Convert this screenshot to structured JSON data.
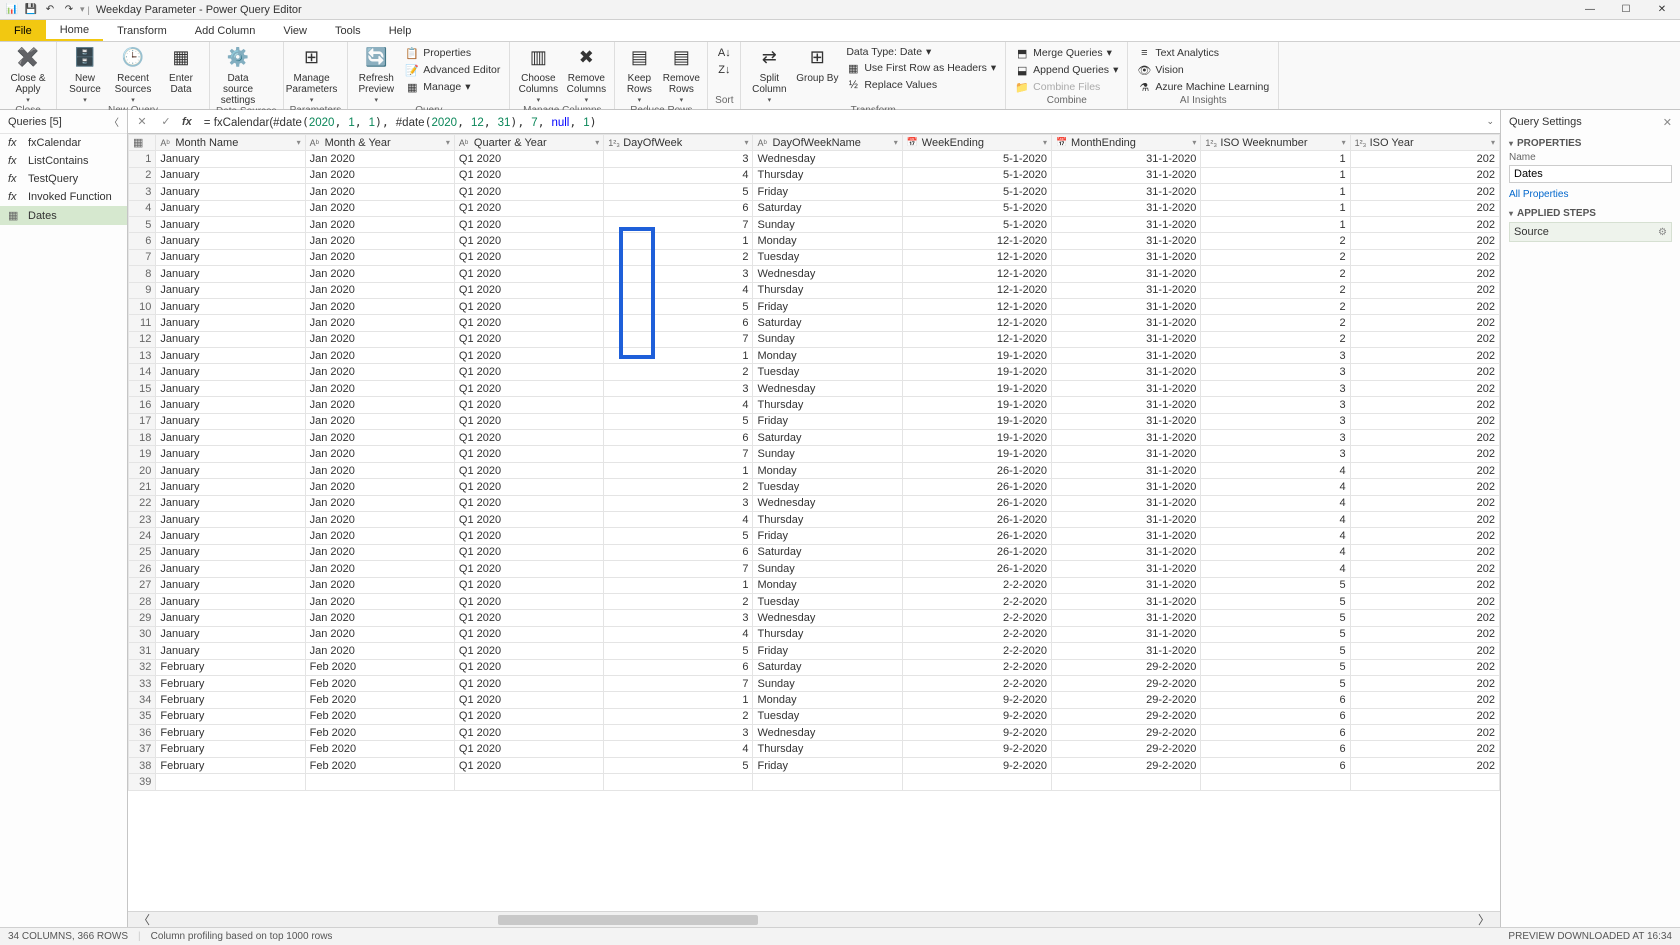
{
  "titlebar": {
    "app_icon": "📊",
    "title": "Weekday Parameter - Power Query Editor",
    "win_min": "—",
    "win_max": "☐",
    "win_close": "✕"
  },
  "ribbon": {
    "tabs": {
      "file": "File",
      "home": "Home",
      "transform": "Transform",
      "add_column": "Add Column",
      "view": "View",
      "tools": "Tools",
      "help": "Help"
    },
    "groups": {
      "close": {
        "label": "Close",
        "close_apply": "Close & Apply"
      },
      "new_query": {
        "label": "New Query",
        "new_source": "New Source",
        "recent_sources": "Recent Sources",
        "enter_data": "Enter Data"
      },
      "data_sources": {
        "label": "Data Sources",
        "data_source_settings": "Data source settings"
      },
      "parameters": {
        "label": "Parameters",
        "manage_parameters": "Manage Parameters"
      },
      "query": {
        "label": "Query",
        "refresh": "Refresh Preview",
        "properties": "Properties",
        "advanced_editor": "Advanced Editor",
        "manage": "Manage"
      },
      "manage_columns": {
        "label": "Manage Columns",
        "choose": "Choose Columns",
        "remove": "Remove Columns"
      },
      "reduce_rows": {
        "label": "Reduce Rows",
        "keep": "Keep Rows",
        "remove": "Remove Rows"
      },
      "sort": {
        "label": "Sort"
      },
      "transform": {
        "label": "Transform",
        "split": "Split Column",
        "group": "Group By",
        "data_type": "Data Type: Date",
        "first_row": "Use First Row as Headers",
        "replace": "Replace Values"
      },
      "combine": {
        "label": "Combine",
        "merge": "Merge Queries",
        "append": "Append Queries",
        "combine_files": "Combine Files"
      },
      "ai": {
        "label": "AI Insights",
        "text": "Text Analytics",
        "vision": "Vision",
        "aml": "Azure Machine Learning"
      }
    }
  },
  "queries": {
    "header": "Queries [5]",
    "items": [
      {
        "icon": "fx",
        "label": "fxCalendar",
        "fx": true
      },
      {
        "icon": "fx",
        "label": "ListContains",
        "fx": true
      },
      {
        "icon": "fx",
        "label": "TestQuery",
        "fx": true
      },
      {
        "icon": "fx",
        "label": "Invoked Function",
        "fx": true
      },
      {
        "icon": "▦",
        "label": "Dates",
        "fx": false,
        "selected": true
      }
    ]
  },
  "formula": {
    "prefix": "= ",
    "func1": "fxCalendar(",
    "func2": "#date",
    "lp": "(",
    "rp": ")",
    "comma": ", ",
    "n2020": "2020",
    "n1": "1",
    "n12": "12",
    "n31": "31",
    "n7": "7",
    "null": "null"
  },
  "grid": {
    "columns": [
      {
        "key": "MonthName",
        "label": "Month Name",
        "type": "Aᵇ",
        "align": "left"
      },
      {
        "key": "MonthYear",
        "label": "Month & Year",
        "type": "Aᵇ",
        "align": "left"
      },
      {
        "key": "QuarterYear",
        "label": "Quarter & Year",
        "type": "Aᵇ",
        "align": "left"
      },
      {
        "key": "DayOfWeek",
        "label": "DayOfWeek",
        "type": "1²₃",
        "align": "right"
      },
      {
        "key": "DayOfWeekName",
        "label": "DayOfWeekName",
        "type": "Aᵇ",
        "align": "left"
      },
      {
        "key": "WeekEnding",
        "label": "WeekEnding",
        "type": "📅",
        "align": "right"
      },
      {
        "key": "MonthEnding",
        "label": "MonthEnding",
        "type": "📅",
        "align": "right"
      },
      {
        "key": "ISOWeek",
        "label": "ISO Weeknumber",
        "type": "1²₃",
        "align": "right"
      },
      {
        "key": "ISOYear",
        "label": "ISO Year",
        "type": "1²₃",
        "align": "right"
      }
    ],
    "rows": [
      {
        "n": 1,
        "MonthName": "January",
        "MonthYear": "Jan 2020",
        "QuarterYear": "Q1 2020",
        "DayOfWeek": "3",
        "DayOfWeekName": "Wednesday",
        "WeekEnding": "5-1-2020",
        "MonthEnding": "31-1-2020",
        "ISOWeek": "1",
        "ISOYear": "202"
      },
      {
        "n": 2,
        "MonthName": "January",
        "MonthYear": "Jan 2020",
        "QuarterYear": "Q1 2020",
        "DayOfWeek": "4",
        "DayOfWeekName": "Thursday",
        "WeekEnding": "5-1-2020",
        "MonthEnding": "31-1-2020",
        "ISOWeek": "1",
        "ISOYear": "202"
      },
      {
        "n": 3,
        "MonthName": "January",
        "MonthYear": "Jan 2020",
        "QuarterYear": "Q1 2020",
        "DayOfWeek": "5",
        "DayOfWeekName": "Friday",
        "WeekEnding": "5-1-2020",
        "MonthEnding": "31-1-2020",
        "ISOWeek": "1",
        "ISOYear": "202"
      },
      {
        "n": 4,
        "MonthName": "January",
        "MonthYear": "Jan 2020",
        "QuarterYear": "Q1 2020",
        "DayOfWeek": "6",
        "DayOfWeekName": "Saturday",
        "WeekEnding": "5-1-2020",
        "MonthEnding": "31-1-2020",
        "ISOWeek": "1",
        "ISOYear": "202"
      },
      {
        "n": 5,
        "MonthName": "January",
        "MonthYear": "Jan 2020",
        "QuarterYear": "Q1 2020",
        "DayOfWeek": "7",
        "DayOfWeekName": "Sunday",
        "WeekEnding": "5-1-2020",
        "MonthEnding": "31-1-2020",
        "ISOWeek": "1",
        "ISOYear": "202"
      },
      {
        "n": 6,
        "MonthName": "January",
        "MonthYear": "Jan 2020",
        "QuarterYear": "Q1 2020",
        "DayOfWeek": "1",
        "DayOfWeekName": "Monday",
        "WeekEnding": "12-1-2020",
        "MonthEnding": "31-1-2020",
        "ISOWeek": "2",
        "ISOYear": "202"
      },
      {
        "n": 7,
        "MonthName": "January",
        "MonthYear": "Jan 2020",
        "QuarterYear": "Q1 2020",
        "DayOfWeek": "2",
        "DayOfWeekName": "Tuesday",
        "WeekEnding": "12-1-2020",
        "MonthEnding": "31-1-2020",
        "ISOWeek": "2",
        "ISOYear": "202"
      },
      {
        "n": 8,
        "MonthName": "January",
        "MonthYear": "Jan 2020",
        "QuarterYear": "Q1 2020",
        "DayOfWeek": "3",
        "DayOfWeekName": "Wednesday",
        "WeekEnding": "12-1-2020",
        "MonthEnding": "31-1-2020",
        "ISOWeek": "2",
        "ISOYear": "202"
      },
      {
        "n": 9,
        "MonthName": "January",
        "MonthYear": "Jan 2020",
        "QuarterYear": "Q1 2020",
        "DayOfWeek": "4",
        "DayOfWeekName": "Thursday",
        "WeekEnding": "12-1-2020",
        "MonthEnding": "31-1-2020",
        "ISOWeek": "2",
        "ISOYear": "202"
      },
      {
        "n": 10,
        "MonthName": "January",
        "MonthYear": "Jan 2020",
        "QuarterYear": "Q1 2020",
        "DayOfWeek": "5",
        "DayOfWeekName": "Friday",
        "WeekEnding": "12-1-2020",
        "MonthEnding": "31-1-2020",
        "ISOWeek": "2",
        "ISOYear": "202"
      },
      {
        "n": 11,
        "MonthName": "January",
        "MonthYear": "Jan 2020",
        "QuarterYear": "Q1 2020",
        "DayOfWeek": "6",
        "DayOfWeekName": "Saturday",
        "WeekEnding": "12-1-2020",
        "MonthEnding": "31-1-2020",
        "ISOWeek": "2",
        "ISOYear": "202"
      },
      {
        "n": 12,
        "MonthName": "January",
        "MonthYear": "Jan 2020",
        "QuarterYear": "Q1 2020",
        "DayOfWeek": "7",
        "DayOfWeekName": "Sunday",
        "WeekEnding": "12-1-2020",
        "MonthEnding": "31-1-2020",
        "ISOWeek": "2",
        "ISOYear": "202"
      },
      {
        "n": 13,
        "MonthName": "January",
        "MonthYear": "Jan 2020",
        "QuarterYear": "Q1 2020",
        "DayOfWeek": "1",
        "DayOfWeekName": "Monday",
        "WeekEnding": "19-1-2020",
        "MonthEnding": "31-1-2020",
        "ISOWeek": "3",
        "ISOYear": "202"
      },
      {
        "n": 14,
        "MonthName": "January",
        "MonthYear": "Jan 2020",
        "QuarterYear": "Q1 2020",
        "DayOfWeek": "2",
        "DayOfWeekName": "Tuesday",
        "WeekEnding": "19-1-2020",
        "MonthEnding": "31-1-2020",
        "ISOWeek": "3",
        "ISOYear": "202"
      },
      {
        "n": 15,
        "MonthName": "January",
        "MonthYear": "Jan 2020",
        "QuarterYear": "Q1 2020",
        "DayOfWeek": "3",
        "DayOfWeekName": "Wednesday",
        "WeekEnding": "19-1-2020",
        "MonthEnding": "31-1-2020",
        "ISOWeek": "3",
        "ISOYear": "202"
      },
      {
        "n": 16,
        "MonthName": "January",
        "MonthYear": "Jan 2020",
        "QuarterYear": "Q1 2020",
        "DayOfWeek": "4",
        "DayOfWeekName": "Thursday",
        "WeekEnding": "19-1-2020",
        "MonthEnding": "31-1-2020",
        "ISOWeek": "3",
        "ISOYear": "202"
      },
      {
        "n": 17,
        "MonthName": "January",
        "MonthYear": "Jan 2020",
        "QuarterYear": "Q1 2020",
        "DayOfWeek": "5",
        "DayOfWeekName": "Friday",
        "WeekEnding": "19-1-2020",
        "MonthEnding": "31-1-2020",
        "ISOWeek": "3",
        "ISOYear": "202"
      },
      {
        "n": 18,
        "MonthName": "January",
        "MonthYear": "Jan 2020",
        "QuarterYear": "Q1 2020",
        "DayOfWeek": "6",
        "DayOfWeekName": "Saturday",
        "WeekEnding": "19-1-2020",
        "MonthEnding": "31-1-2020",
        "ISOWeek": "3",
        "ISOYear": "202"
      },
      {
        "n": 19,
        "MonthName": "January",
        "MonthYear": "Jan 2020",
        "QuarterYear": "Q1 2020",
        "DayOfWeek": "7",
        "DayOfWeekName": "Sunday",
        "WeekEnding": "19-1-2020",
        "MonthEnding": "31-1-2020",
        "ISOWeek": "3",
        "ISOYear": "202"
      },
      {
        "n": 20,
        "MonthName": "January",
        "MonthYear": "Jan 2020",
        "QuarterYear": "Q1 2020",
        "DayOfWeek": "1",
        "DayOfWeekName": "Monday",
        "WeekEnding": "26-1-2020",
        "MonthEnding": "31-1-2020",
        "ISOWeek": "4",
        "ISOYear": "202"
      },
      {
        "n": 21,
        "MonthName": "January",
        "MonthYear": "Jan 2020",
        "QuarterYear": "Q1 2020",
        "DayOfWeek": "2",
        "DayOfWeekName": "Tuesday",
        "WeekEnding": "26-1-2020",
        "MonthEnding": "31-1-2020",
        "ISOWeek": "4",
        "ISOYear": "202"
      },
      {
        "n": 22,
        "MonthName": "January",
        "MonthYear": "Jan 2020",
        "QuarterYear": "Q1 2020",
        "DayOfWeek": "3",
        "DayOfWeekName": "Wednesday",
        "WeekEnding": "26-1-2020",
        "MonthEnding": "31-1-2020",
        "ISOWeek": "4",
        "ISOYear": "202"
      },
      {
        "n": 23,
        "MonthName": "January",
        "MonthYear": "Jan 2020",
        "QuarterYear": "Q1 2020",
        "DayOfWeek": "4",
        "DayOfWeekName": "Thursday",
        "WeekEnding": "26-1-2020",
        "MonthEnding": "31-1-2020",
        "ISOWeek": "4",
        "ISOYear": "202"
      },
      {
        "n": 24,
        "MonthName": "January",
        "MonthYear": "Jan 2020",
        "QuarterYear": "Q1 2020",
        "DayOfWeek": "5",
        "DayOfWeekName": "Friday",
        "WeekEnding": "26-1-2020",
        "MonthEnding": "31-1-2020",
        "ISOWeek": "4",
        "ISOYear": "202"
      },
      {
        "n": 25,
        "MonthName": "January",
        "MonthYear": "Jan 2020",
        "QuarterYear": "Q1 2020",
        "DayOfWeek": "6",
        "DayOfWeekName": "Saturday",
        "WeekEnding": "26-1-2020",
        "MonthEnding": "31-1-2020",
        "ISOWeek": "4",
        "ISOYear": "202"
      },
      {
        "n": 26,
        "MonthName": "January",
        "MonthYear": "Jan 2020",
        "QuarterYear": "Q1 2020",
        "DayOfWeek": "7",
        "DayOfWeekName": "Sunday",
        "WeekEnding": "26-1-2020",
        "MonthEnding": "31-1-2020",
        "ISOWeek": "4",
        "ISOYear": "202"
      },
      {
        "n": 27,
        "MonthName": "January",
        "MonthYear": "Jan 2020",
        "QuarterYear": "Q1 2020",
        "DayOfWeek": "1",
        "DayOfWeekName": "Monday",
        "WeekEnding": "2-2-2020",
        "MonthEnding": "31-1-2020",
        "ISOWeek": "5",
        "ISOYear": "202"
      },
      {
        "n": 28,
        "MonthName": "January",
        "MonthYear": "Jan 2020",
        "QuarterYear": "Q1 2020",
        "DayOfWeek": "2",
        "DayOfWeekName": "Tuesday",
        "WeekEnding": "2-2-2020",
        "MonthEnding": "31-1-2020",
        "ISOWeek": "5",
        "ISOYear": "202"
      },
      {
        "n": 29,
        "MonthName": "January",
        "MonthYear": "Jan 2020",
        "QuarterYear": "Q1 2020",
        "DayOfWeek": "3",
        "DayOfWeekName": "Wednesday",
        "WeekEnding": "2-2-2020",
        "MonthEnding": "31-1-2020",
        "ISOWeek": "5",
        "ISOYear": "202"
      },
      {
        "n": 30,
        "MonthName": "January",
        "MonthYear": "Jan 2020",
        "QuarterYear": "Q1 2020",
        "DayOfWeek": "4",
        "DayOfWeekName": "Thursday",
        "WeekEnding": "2-2-2020",
        "MonthEnding": "31-1-2020",
        "ISOWeek": "5",
        "ISOYear": "202"
      },
      {
        "n": 31,
        "MonthName": "January",
        "MonthYear": "Jan 2020",
        "QuarterYear": "Q1 2020",
        "DayOfWeek": "5",
        "DayOfWeekName": "Friday",
        "WeekEnding": "2-2-2020",
        "MonthEnding": "31-1-2020",
        "ISOWeek": "5",
        "ISOYear": "202"
      },
      {
        "n": 32,
        "MonthName": "February",
        "MonthYear": "Feb 2020",
        "QuarterYear": "Q1 2020",
        "DayOfWeek": "6",
        "DayOfWeekName": "Saturday",
        "WeekEnding": "2-2-2020",
        "MonthEnding": "29-2-2020",
        "ISOWeek": "5",
        "ISOYear": "202"
      },
      {
        "n": 33,
        "MonthName": "February",
        "MonthYear": "Feb 2020",
        "QuarterYear": "Q1 2020",
        "DayOfWeek": "7",
        "DayOfWeekName": "Sunday",
        "WeekEnding": "2-2-2020",
        "MonthEnding": "29-2-2020",
        "ISOWeek": "5",
        "ISOYear": "202"
      },
      {
        "n": 34,
        "MonthName": "February",
        "MonthYear": "Feb 2020",
        "QuarterYear": "Q1 2020",
        "DayOfWeek": "1",
        "DayOfWeekName": "Monday",
        "WeekEnding": "9-2-2020",
        "MonthEnding": "29-2-2020",
        "ISOWeek": "6",
        "ISOYear": "202"
      },
      {
        "n": 35,
        "MonthName": "February",
        "MonthYear": "Feb 2020",
        "QuarterYear": "Q1 2020",
        "DayOfWeek": "2",
        "DayOfWeekName": "Tuesday",
        "WeekEnding": "9-2-2020",
        "MonthEnding": "29-2-2020",
        "ISOWeek": "6",
        "ISOYear": "202"
      },
      {
        "n": 36,
        "MonthName": "February",
        "MonthYear": "Feb 2020",
        "QuarterYear": "Q1 2020",
        "DayOfWeek": "3",
        "DayOfWeekName": "Wednesday",
        "WeekEnding": "9-2-2020",
        "MonthEnding": "29-2-2020",
        "ISOWeek": "6",
        "ISOYear": "202"
      },
      {
        "n": 37,
        "MonthName": "February",
        "MonthYear": "Feb 2020",
        "QuarterYear": "Q1 2020",
        "DayOfWeek": "4",
        "DayOfWeekName": "Thursday",
        "WeekEnding": "9-2-2020",
        "MonthEnding": "29-2-2020",
        "ISOWeek": "6",
        "ISOYear": "202"
      },
      {
        "n": 38,
        "MonthName": "February",
        "MonthYear": "Feb 2020",
        "QuarterYear": "Q1 2020",
        "DayOfWeek": "5",
        "DayOfWeekName": "Friday",
        "WeekEnding": "9-2-2020",
        "MonthEnding": "29-2-2020",
        "ISOWeek": "6",
        "ISOYear": "202"
      },
      {
        "n": 39,
        "MonthName": "",
        "MonthYear": "",
        "QuarterYear": "",
        "DayOfWeek": "",
        "DayOfWeekName": "",
        "WeekEnding": "",
        "MonthEnding": "",
        "ISOWeek": "",
        "ISOYear": ""
      }
    ]
  },
  "settings": {
    "header": "Query Settings",
    "properties": "PROPERTIES",
    "name_label": "Name",
    "name_value": "Dates",
    "all_properties": "All Properties",
    "applied_steps": "APPLIED STEPS",
    "step_source": "Source"
  },
  "status": {
    "left1": "34 COLUMNS, 366 ROWS",
    "left2": "Column profiling based on top 1000 rows",
    "right": "PREVIEW DOWNLOADED AT 16:34"
  }
}
